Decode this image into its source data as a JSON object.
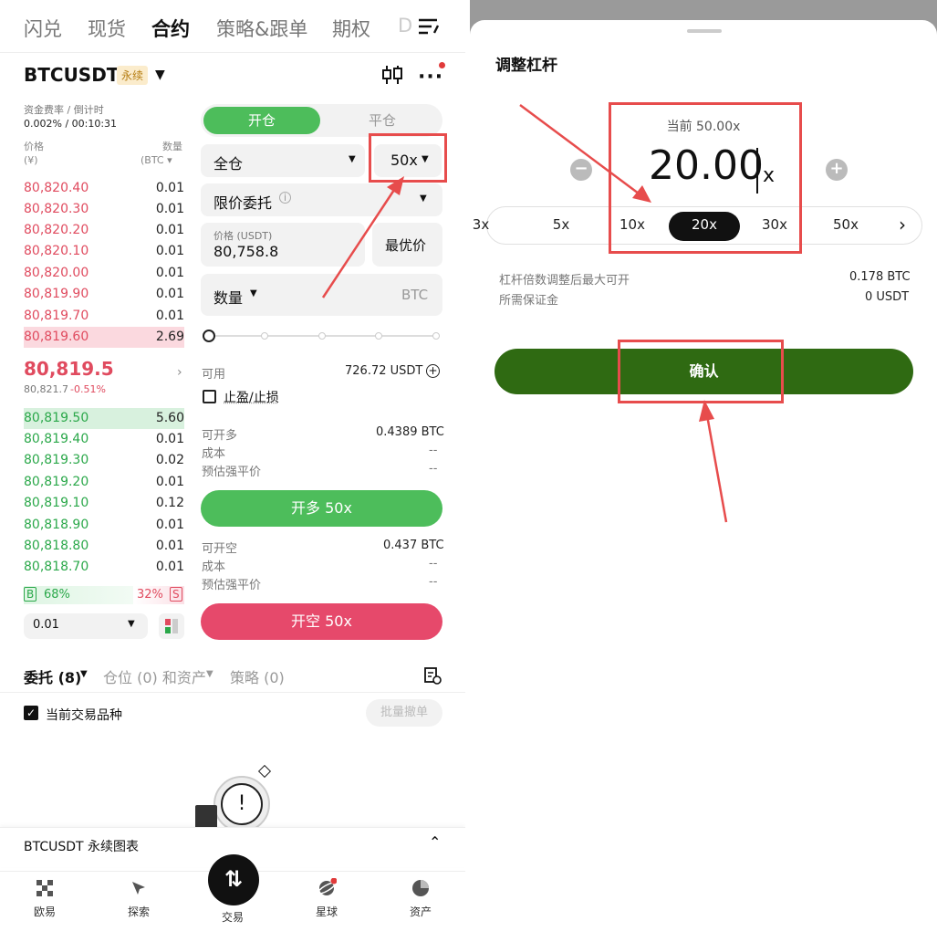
{
  "top_tabs": [
    "闪兑",
    "现货",
    "合约",
    "策略&跟单",
    "期权",
    "D"
  ],
  "symbol": "BTCUSDT",
  "symbol_tag": "永续",
  "funding": {
    "label": "资金费率 / 倒计时",
    "value": "0.002% / 00:10:31"
  },
  "orderbook": {
    "price_header": "价格",
    "price_unit": "(¥)",
    "qty_header": "数量",
    "qty_unit": "(BTC ▾",
    "asks": [
      {
        "price": "80,820.40",
        "qty": "0.01"
      },
      {
        "price": "80,820.30",
        "qty": "0.01"
      },
      {
        "price": "80,820.20",
        "qty": "0.01"
      },
      {
        "price": "80,820.10",
        "qty": "0.01"
      },
      {
        "price": "80,820.00",
        "qty": "0.01"
      },
      {
        "price": "80,819.90",
        "qty": "0.01"
      },
      {
        "price": "80,819.70",
        "qty": "0.01"
      },
      {
        "price": "80,819.60",
        "qty": "2.69"
      }
    ],
    "last_price": "80,819.5",
    "mark_price": "80,821.7",
    "change": "-0.51%",
    "bids": [
      {
        "price": "80,819.50",
        "qty": "5.60"
      },
      {
        "price": "80,819.40",
        "qty": "0.01"
      },
      {
        "price": "80,819.30",
        "qty": "0.02"
      },
      {
        "price": "80,819.20",
        "qty": "0.01"
      },
      {
        "price": "80,819.10",
        "qty": "0.12"
      },
      {
        "price": "80,818.90",
        "qty": "0.01"
      },
      {
        "price": "80,818.80",
        "qty": "0.01"
      },
      {
        "price": "80,818.70",
        "qty": "0.01"
      }
    ],
    "buy_tag": "B",
    "buy_pct": "68%",
    "sell_pct": "32%",
    "sell_tag": "S",
    "tick": "0.01"
  },
  "trade": {
    "open_tab": "开仓",
    "close_tab": "平仓",
    "margin_mode": "全仓",
    "leverage": "50x",
    "order_type": "限价委托",
    "price_label": "价格 (USDT)",
    "price_value": "80,758.8",
    "best_price": "最优价",
    "qty_label": "数量",
    "qty_unit": "BTC",
    "available_label": "可用",
    "available_value": "726.72 USDT",
    "tpsl_label": "止盈/止损",
    "long_max_label": "可开多",
    "long_max_value": "0.4389 BTC",
    "cost_label": "成本",
    "cost_value": "--",
    "liq_label": "预估强平价",
    "liq_value": "--",
    "long_button": "开多 50x",
    "short_max_label": "可开空",
    "short_max_value": "0.437 BTC",
    "cost2_value": "--",
    "liq2_value": "--",
    "short_button": "开空 50x"
  },
  "bottom_tabs": {
    "orders": "委托 (8)",
    "positions": "仓位 (0) 和资产",
    "strategy": "策略 (0)",
    "current_only": "当前交易品种",
    "batch_cancel": "批量撤单"
  },
  "chart_bar": "BTCUSDT 永续图表",
  "nav": [
    "欧易",
    "探索",
    "交易",
    "星球",
    "资产"
  ],
  "modal": {
    "title": "调整杠杆",
    "current": "当前 50.00x",
    "value": "20.00",
    "unit": "x",
    "options": [
      "3x",
      "5x",
      "10x",
      "20x",
      "30x",
      "50x"
    ],
    "selected": "20x",
    "info1_label": "杠杆倍数调整后最大可开",
    "info1_value": "0.178 BTC",
    "info2_label": "所需保证金",
    "info2_value": "0 USDT",
    "confirm": "确认"
  },
  "colors": {
    "ask": "#e04b5f",
    "bid": "#2ba84a",
    "long_btn": "#4dbd5b",
    "short_btn": "#e6496b",
    "confirm_btn": "#2f6a12",
    "highlight": "#e74c4c"
  }
}
